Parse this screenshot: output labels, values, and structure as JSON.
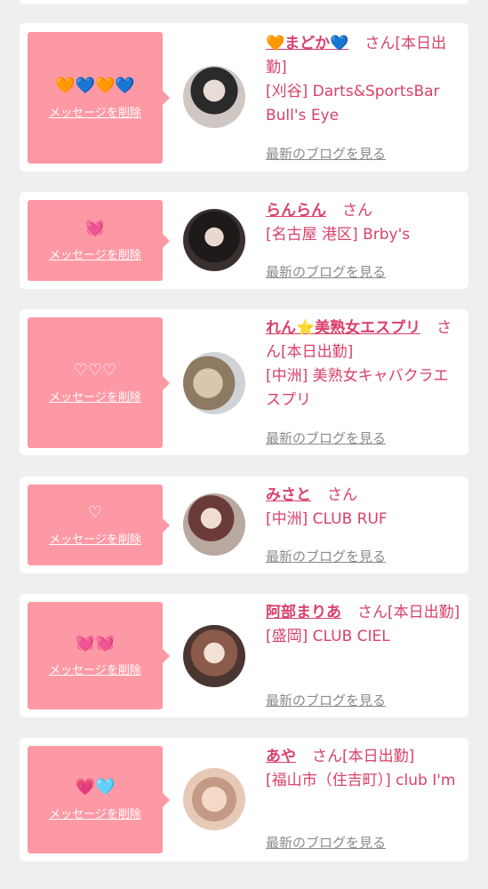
{
  "delete_label": "メッセージを削除",
  "blog_label": "最新のブログを見る",
  "accent_color": "#d9416b",
  "bubble_color": "#fd99a5",
  "messages": [
    {
      "name": "🧡まどか💙",
      "suffix": "さん[本日出勤]",
      "shop": "[刈谷] Darts&SportsBar Bull's Eye",
      "emoji": "🧡💙🧡💙"
    },
    {
      "name": "らんらん",
      "suffix": "さん",
      "shop": "[名古屋 港区] Brby's",
      "emoji": "💓"
    },
    {
      "name": "れん⭐美熟女エスプリ",
      "suffix": "さん[本日出勤]",
      "shop": "[中洲] 美熟女キャバクラエスプリ",
      "emoji": "♡♡♡"
    },
    {
      "name": "みさと",
      "suffix": "さん",
      "shop": "[中洲] CLUB RUF",
      "emoji": "♡"
    },
    {
      "name": "阿部まりあ",
      "suffix": "さん[本日出勤]",
      "shop": "[盛岡] CLUB CIEL",
      "emoji": "💓💓"
    },
    {
      "name": "あや",
      "suffix": "さん[本日出勤]",
      "shop": "[福山市（住吉町）] club I'm",
      "emoji": "💗🩵"
    }
  ]
}
